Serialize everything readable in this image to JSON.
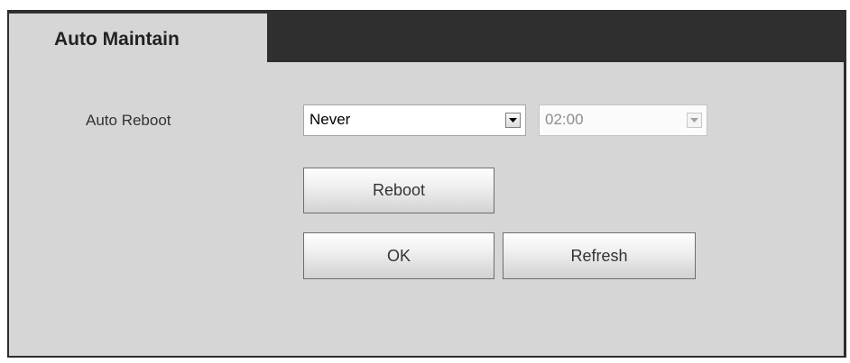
{
  "tab": {
    "title": "Auto Maintain"
  },
  "form": {
    "auto_reboot": {
      "label": "Auto Reboot",
      "frequency_value": "Never",
      "time_value": "02:00"
    }
  },
  "buttons": {
    "reboot": "Reboot",
    "ok": "OK",
    "refresh": "Refresh"
  },
  "icons": {
    "dropdown": "chevron-down-icon"
  },
  "colors": {
    "frame": "#2d2d2d",
    "panel": "#d6d6d6"
  }
}
